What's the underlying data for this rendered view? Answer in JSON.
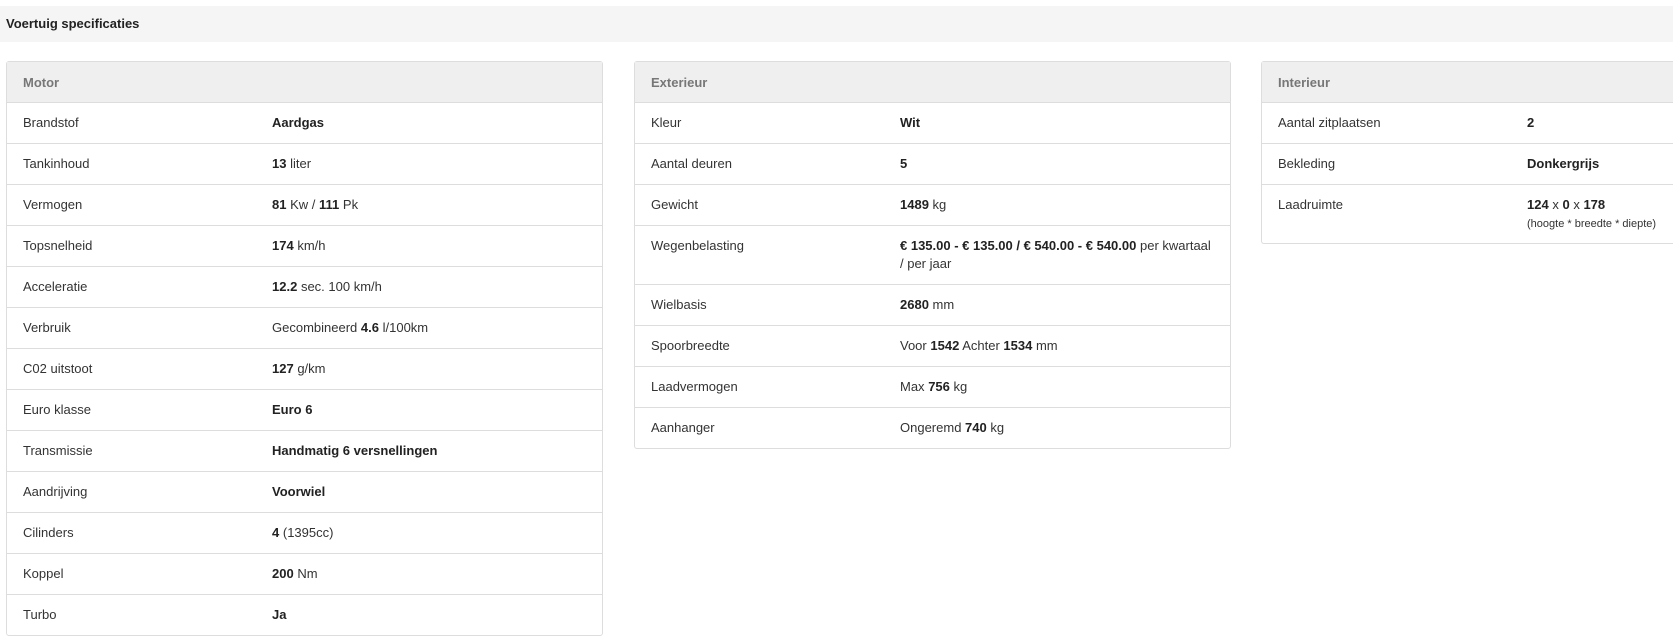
{
  "header": {
    "title": "Voertuig specificaties"
  },
  "motor": {
    "title": "Motor",
    "brandstof": {
      "label": "Brandstof",
      "value": "Aardgas"
    },
    "tankinhoud": {
      "label": "Tankinhoud",
      "value": "13",
      "unit": "liter"
    },
    "vermogen": {
      "label": "Vermogen",
      "kw": "81",
      "kw_unit": "Kw",
      "sep": "/",
      "pk": "111",
      "pk_unit": "Pk"
    },
    "topsnelheid": {
      "label": "Topsnelheid",
      "value": "174",
      "unit": "km/h"
    },
    "acceleratie": {
      "label": "Acceleratie",
      "value": "12.2",
      "unit": "sec. 100 km/h"
    },
    "verbruik": {
      "label": "Verbruik",
      "prefix": "Gecombineerd",
      "value": "4.6",
      "unit": "l/100km"
    },
    "co2": {
      "label": "C02 uitstoot",
      "value": "127",
      "unit": "g/km"
    },
    "euroklasse": {
      "label": "Euro klasse",
      "value": "Euro 6"
    },
    "transmissie": {
      "label": "Transmissie",
      "value": "Handmatig 6 versnellingen"
    },
    "aandrijving": {
      "label": "Aandrijving",
      "value": "Voorwiel"
    },
    "cilinders": {
      "label": "Cilinders",
      "value": "4",
      "extra": "(1395cc)"
    },
    "koppel": {
      "label": "Koppel",
      "value": "200",
      "unit": "Nm"
    },
    "turbo": {
      "label": "Turbo",
      "value": "Ja"
    }
  },
  "exterieur": {
    "title": "Exterieur",
    "kleur": {
      "label": "Kleur",
      "value": "Wit"
    },
    "deuren": {
      "label": "Aantal deuren",
      "value": "5"
    },
    "gewicht": {
      "label": "Gewicht",
      "value": "1489",
      "unit": "kg"
    },
    "wegenbelasting": {
      "label": "Wegenbelasting",
      "value": "€ 135.00 - € 135.00 / € 540.00 - € 540.00",
      "unit": "per kwartaal / per jaar"
    },
    "wielbasis": {
      "label": "Wielbasis",
      "value": "2680",
      "unit": "mm"
    },
    "spoorbreedte": {
      "label": "Spoorbreedte",
      "voor_label": "Voor",
      "voor": "1542",
      "achter_label": "Achter",
      "achter": "1534",
      "unit": "mm"
    },
    "laadvermogen": {
      "label": "Laadvermogen",
      "prefix": "Max",
      "value": "756",
      "unit": "kg"
    },
    "aanhanger": {
      "label": "Aanhanger",
      "prefix": "Ongeremd",
      "value": "740",
      "unit": "kg"
    }
  },
  "interieur": {
    "title": "Interieur",
    "zitplaatsen": {
      "label": "Aantal zitplaatsen",
      "value": "2"
    },
    "bekleding": {
      "label": "Bekleding",
      "value": "Donkergrijs"
    },
    "laadruimte": {
      "label": "Laadruimte",
      "h": "124",
      "x1": "x",
      "b": "0",
      "x2": "x",
      "d": "178",
      "note": "(hoogte * breedte * diepte)"
    }
  }
}
